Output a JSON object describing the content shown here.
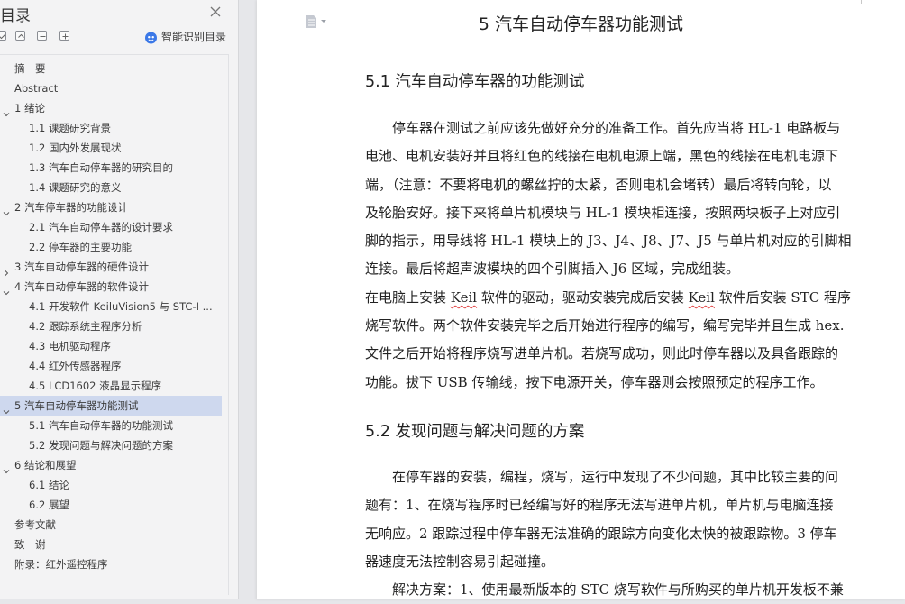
{
  "toc": {
    "title": "目录",
    "smart_label": "智能识别目录",
    "items": [
      {
        "label": "摘　要",
        "level": 1,
        "chevron": null
      },
      {
        "label": "Abstract",
        "level": 1,
        "chevron": null
      },
      {
        "label": "1 绪论",
        "level": 1,
        "chevron": "down"
      },
      {
        "label": "1.1 课题研究背景",
        "level": 2,
        "chevron": null
      },
      {
        "label": "1.2 国内外发展现状",
        "level": 2,
        "chevron": null
      },
      {
        "label": "1.3 汽车自动停车器的研究目的",
        "level": 2,
        "chevron": null
      },
      {
        "label": "1.4 课题研究的意义",
        "level": 2,
        "chevron": null
      },
      {
        "label": "2 汽车停车器的功能设计",
        "level": 1,
        "chevron": "down"
      },
      {
        "label": "2.1 汽车自动停车器的设计要求",
        "level": 2,
        "chevron": null
      },
      {
        "label": "2.2 停车器的主要功能",
        "level": 2,
        "chevron": null
      },
      {
        "label": "3 汽车自动停车器的硬件设计",
        "level": 1,
        "chevron": "right"
      },
      {
        "label": "4 汽车自动停车器的软件设计",
        "level": 1,
        "chevron": "down"
      },
      {
        "label": "4.1 开发软件 KeiluVision5 与 STC-I ...",
        "level": 2,
        "chevron": null
      },
      {
        "label": "4.2 跟踪系统主程序分析",
        "level": 2,
        "chevron": null
      },
      {
        "label": "4.3 电机驱动程序",
        "level": 2,
        "chevron": null
      },
      {
        "label": "4.4 红外传感器程序",
        "level": 2,
        "chevron": null
      },
      {
        "label": "4.5 LCD1602 液晶显示程序",
        "level": 2,
        "chevron": null
      },
      {
        "label": "5 汽车自动停车器功能测试",
        "level": 1,
        "chevron": "down",
        "active": true
      },
      {
        "label": "5.1 汽车自动停车器的功能测试",
        "level": 2,
        "chevron": null
      },
      {
        "label": "5.2 发现问题与解决问题的方案",
        "level": 2,
        "chevron": null
      },
      {
        "label": "6 结论和展望",
        "level": 1,
        "chevron": "down"
      },
      {
        "label": "6.1 结论",
        "level": 2,
        "chevron": null
      },
      {
        "label": "6.2 展望",
        "level": 2,
        "chevron": null
      },
      {
        "label": "参考文献",
        "level": 1,
        "chevron": null
      },
      {
        "label": "致　谢",
        "level": 1,
        "chevron": null
      },
      {
        "label": "附录：红外遥控程序",
        "level": 1,
        "chevron": null
      }
    ]
  },
  "document": {
    "chapter_title": "5 汽车自动停车器功能测试",
    "section1_title": "5.1 汽车自动停车器的功能测试",
    "section1_lines": [
      "停车器在测试之前应该先做好充分的准备工作。首先应当将 HL-1 电路板与",
      "电池、电机安装好并且将红色的线接在电机电源上端，黑色的线接在电机电源下",
      "端，（注意：不要将电机的螺丝拧的太紧，否则电机会堵转）最后将转向轮，以",
      "及轮胎安好。接下来将单片机模块与 HL-1 模块相连接，按照两块板子上对应引",
      "脚的指示，用导线将 HL-1 模块上的 J3、J4、J8、J7、J5 与单片机对应的引脚相",
      "连接。最后将超声波模块的四个引脚插入 J6 区域，完成组装。"
    ],
    "section1_p2": {
      "l1a": "在电脑上安装 ",
      "l1b": "Keil",
      "l1c": " 软件的驱动，驱动安装完成后安装 ",
      "l1d": "Keil",
      "l1e": " 软件后安装 STC 程序",
      "l2": "烧写软件。两个软件安装完毕之后开始进行程序的编写，编写完毕并且生成 hex.",
      "l3": "文件之后开始将程序烧写进单片机。若烧写成功，则此时停车器以及具备跟踪的",
      "l4": "功能。拔下 USB 传输线，按下电源开关，停车器则会按照预定的程序工作。"
    },
    "section2_title": "5.2 发现问题与解决问题的方案",
    "section2_lines": [
      "在停车器的安装，编程，烧写，运行中发现了不少问题，其中比较主要的问",
      "题有：1、在烧写程序时已经编写好的程序无法写进单片机，单片机与电脑连接",
      "无响应。2 跟踪过程中停车器无法准确的跟踪方向变化太快的被跟踪物。3 停车",
      "器速度无法控制容易引起碰撞。",
      "解决方案：1、使用最新版本的 STC 烧写软件与所购买的单片机开发板不兼"
    ]
  },
  "colors": {
    "panel_bg": "#f3f3f4",
    "active_bg": "#ced8ee",
    "smart_icon": "#3b78e7",
    "spell_underline": "#e04040"
  },
  "icons": [
    "close-icon",
    "collapse-all-icon",
    "expand-up-icon",
    "add-icon",
    "smart-toc-icon",
    "chevron-down-icon",
    "chevron-right-icon",
    "document-icon"
  ]
}
